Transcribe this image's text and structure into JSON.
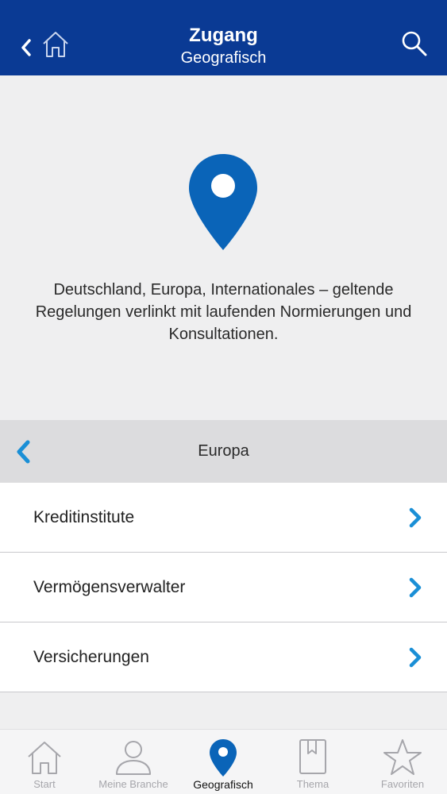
{
  "header": {
    "title": "Zugang",
    "subtitle": "Geografisch",
    "back_icon": "chevron-left-icon",
    "home_icon": "home-icon",
    "search_icon": "search-icon"
  },
  "hero": {
    "icon": "map-pin-icon",
    "description": "Deutschland, Europa, Internationales – geltende Regelungen verlinkt mit laufenden Normierungen und Konsultationen."
  },
  "section": {
    "label": "Europa",
    "back_icon": "chevron-left-icon"
  },
  "list": {
    "items": [
      {
        "label": "Kreditinstitute"
      },
      {
        "label": "Vermögensverwalter"
      },
      {
        "label": "Versicherungen"
      }
    ]
  },
  "tabbar": {
    "tabs": [
      {
        "label": "Start",
        "icon": "home-icon"
      },
      {
        "label": "Meine Branche",
        "icon": "person-icon"
      },
      {
        "label": "Geografisch",
        "icon": "map-pin-icon",
        "active": true
      },
      {
        "label": "Thema",
        "icon": "bookmark-icon"
      },
      {
        "label": "Favoriten",
        "icon": "star-icon"
      }
    ]
  },
  "colors": {
    "header_bg": "#0a3a94",
    "accent": "#0a64b8",
    "chevron": "#1a8fd6",
    "inactive": "#a6a6ab"
  }
}
